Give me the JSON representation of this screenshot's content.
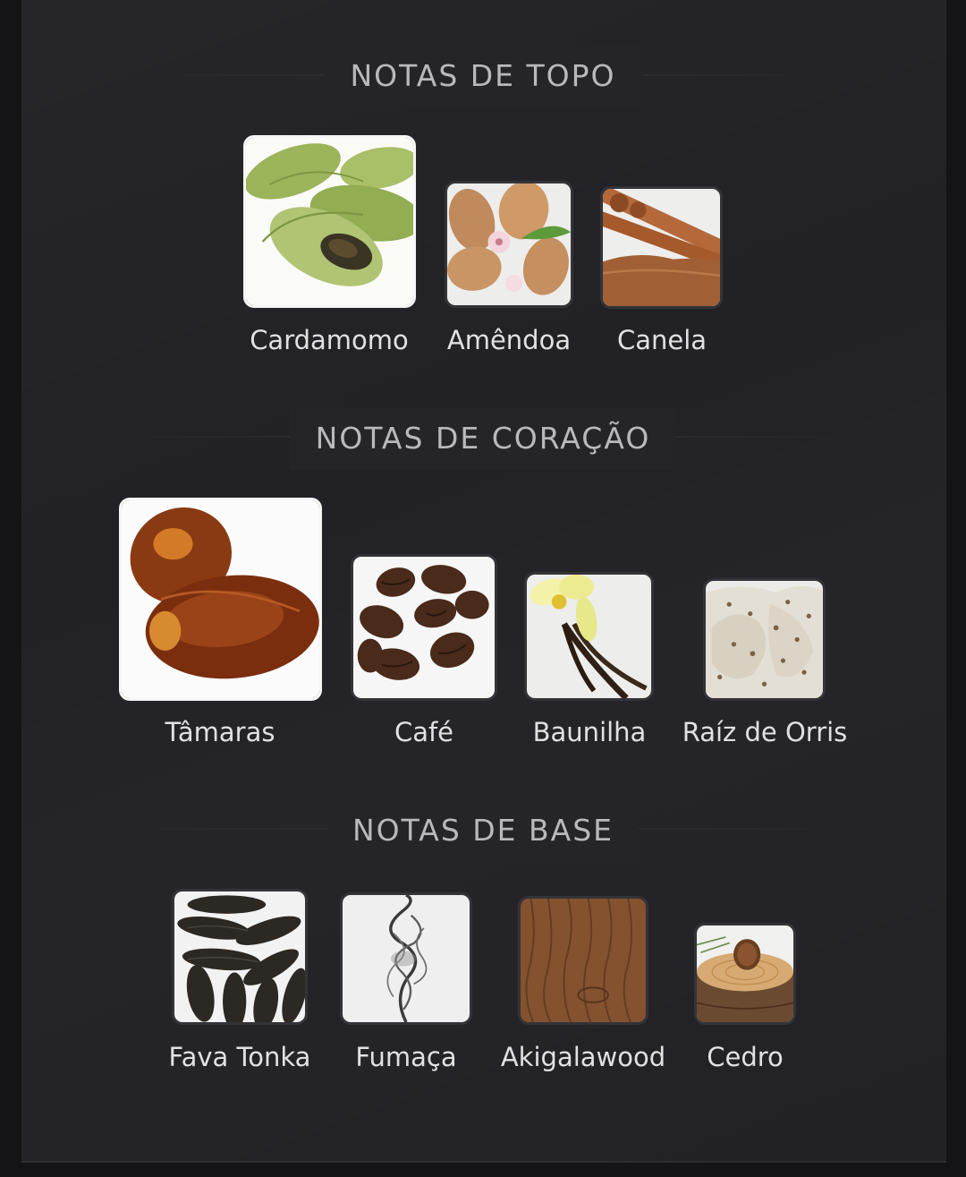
{
  "sections": [
    {
      "title": "NOTAS DE TOPO",
      "notes": [
        {
          "label": "Cardamomo",
          "icon": "cardamom-icon"
        },
        {
          "label": "Amêndoa",
          "icon": "almond-icon"
        },
        {
          "label": "Canela",
          "icon": "cinnamon-icon"
        }
      ]
    },
    {
      "title": "NOTAS DE CORAÇÃO",
      "notes": [
        {
          "label": "Tâmaras",
          "icon": "dates-icon"
        },
        {
          "label": "Café",
          "icon": "coffee-beans-icon"
        },
        {
          "label": "Baunilha",
          "icon": "vanilla-icon"
        },
        {
          "label": "Raíz de Orris",
          "icon": "orris-root-icon"
        }
      ]
    },
    {
      "title": "NOTAS DE BASE",
      "notes": [
        {
          "label": "Fava Tonka",
          "icon": "tonka-bean-icon"
        },
        {
          "label": "Fumaça",
          "icon": "smoke-icon"
        },
        {
          "label": "Akigalawood",
          "icon": "wood-grain-icon"
        },
        {
          "label": "Cedro",
          "icon": "cedar-log-icon"
        }
      ]
    }
  ],
  "colors": {
    "background": "#141416",
    "card": "#222226",
    "title_text": "#b9b9bd",
    "label_text": "#e1e1e4"
  }
}
